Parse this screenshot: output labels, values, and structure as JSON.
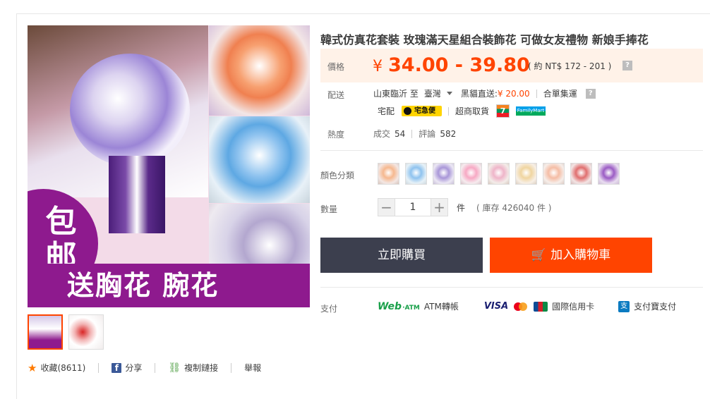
{
  "product": {
    "title": "韓式仿真花套裝 玫瑰滿天星組合裝飾花 可做女友禮物 新娘手捧花",
    "image_promo": {
      "circle_line1": "包",
      "circle_line2": "邮",
      "band": "送胸花 腕花"
    }
  },
  "price": {
    "label": "價格",
    "currency_symbol": "¥",
    "range": "34.00 - 39.80",
    "ntd": "( 約 NT$ 172 - 201 )",
    "help": "?"
  },
  "shipping": {
    "label": "配送",
    "from_to": "山東臨沂 至",
    "destination": "臺灣",
    "direct_label": "黑貓直送:",
    "direct_price": "¥ 20.00",
    "combine": "合單集運",
    "help": "?",
    "home_delivery": "宅配",
    "cat_logo": "宅急便",
    "store_pickup": "超商取貨",
    "seven_logo": "7",
    "familymart_logo": "FamilyMart"
  },
  "stats": {
    "label": "熱度",
    "sold_label": "成交",
    "sold": "54",
    "reviews_label": "評論",
    "reviews": "582"
  },
  "variants": {
    "label": "顏色分類",
    "count": 9
  },
  "quantity": {
    "label": "數量",
    "minus": "−",
    "value": "1",
    "plus": "+",
    "unit": "件",
    "stock": "( 庫存 426040 件 )"
  },
  "actions": {
    "buy_now": "立即購買",
    "add_to_cart": "加入購物車",
    "cart_icon": "🛒"
  },
  "payment": {
    "label": "支付",
    "webatm": "Web",
    "webatm_small": "·ATM",
    "atm_transfer": "ATM轉帳",
    "visa": "VISA",
    "credit_card": "國際信用卡",
    "alipay_icon": "支",
    "alipay": "支付寶支付"
  },
  "social": {
    "favorite": "收藏(8611)",
    "share": "分享",
    "copy_link": "複制鏈接",
    "report": "舉報",
    "fb_glyph": "f",
    "star_glyph": "★",
    "link_glyph": "⛓"
  },
  "colors": {
    "price_accent": "#ff4400",
    "buy_button": "#3c3f4e",
    "promo_purple": "#8e1a8e"
  }
}
